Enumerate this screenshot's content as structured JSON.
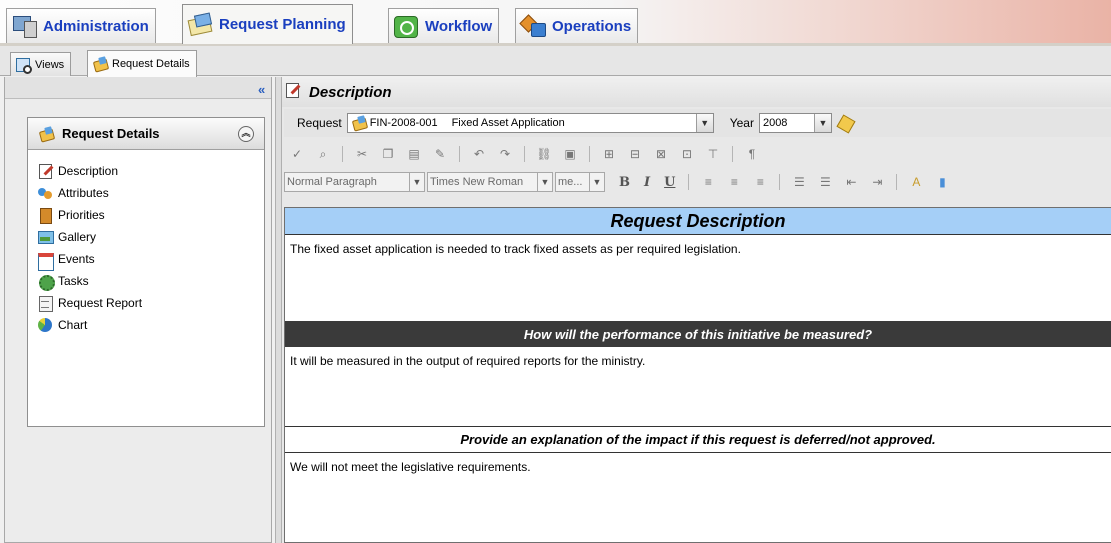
{
  "main_tabs": [
    {
      "label": "Administration",
      "icon": "admin-icon"
    },
    {
      "label": "Request Planning",
      "icon": "request-planning-icon"
    },
    {
      "label": "Workflow",
      "icon": "workflow-icon"
    },
    {
      "label": "Operations",
      "icon": "operations-icon"
    }
  ],
  "sub_tabs": [
    {
      "label": "Views",
      "icon": "views-icon"
    },
    {
      "label": "Request Details",
      "icon": "request-details-icon"
    }
  ],
  "left_panel": {
    "title": "Request Details",
    "items": [
      {
        "label": "Description",
        "icon": "description-icon"
      },
      {
        "label": "Attributes",
        "icon": "attributes-icon"
      },
      {
        "label": "Priorities",
        "icon": "priorities-icon"
      },
      {
        "label": "Gallery",
        "icon": "gallery-icon"
      },
      {
        "label": "Events",
        "icon": "events-icon"
      },
      {
        "label": "Tasks",
        "icon": "tasks-icon"
      },
      {
        "label": "Request Report",
        "icon": "request-report-icon"
      },
      {
        "label": "Chart",
        "icon": "chart-icon"
      }
    ]
  },
  "content": {
    "title": "Description",
    "request_label": "Request",
    "request_id": "FIN-2008-001",
    "request_name": "Fixed Asset Application",
    "year_label": "Year",
    "year_value": "2008"
  },
  "format_bar": {
    "paragraph": "Normal Paragraph",
    "font": "Times New Roman",
    "size": "me...",
    "bold": "B",
    "italic": "I",
    "underline": "U"
  },
  "editor": {
    "heading": "Request Description",
    "description": "The fixed asset application is needed to track fixed assets as per required legislation.",
    "q1": "How will the performance of this initiative be measured?",
    "a1": "It will be measured in the output of required reports for the ministry.",
    "q2": "Provide an explanation of the impact if this request is deferred/not approved.",
    "a2": "We will not meet the legislative requirements."
  },
  "colors": {
    "tab_text": "#1a3fbf",
    "heading_band": "#a5cff7",
    "dark_band": "#3a3a3a"
  }
}
